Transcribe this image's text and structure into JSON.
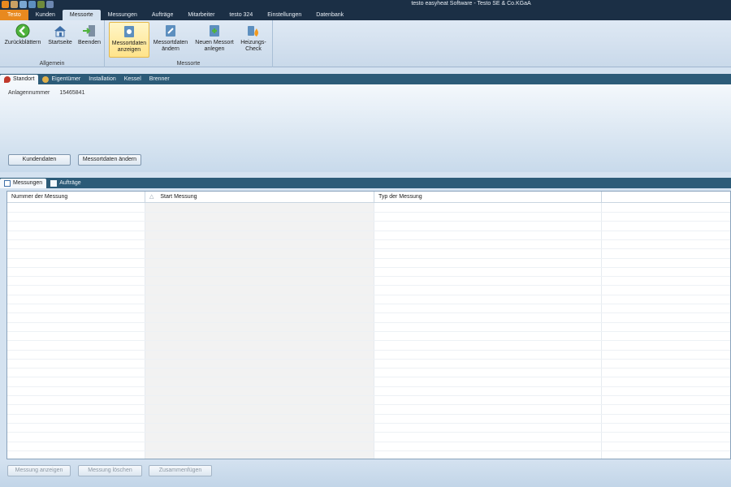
{
  "window": {
    "title": "testo easyheat Software - Testo SE & Co.KGaA"
  },
  "ribbon_tabs": [
    {
      "label": "Testo",
      "kind": "app"
    },
    {
      "label": "Kunden",
      "kind": "normal"
    },
    {
      "label": "Messorte",
      "kind": "active"
    },
    {
      "label": "Messungen",
      "kind": "normal"
    },
    {
      "label": "Aufträge",
      "kind": "normal"
    },
    {
      "label": "Mitarbeiter",
      "kind": "normal"
    },
    {
      "label": "testo 324",
      "kind": "normal"
    },
    {
      "label": "Einstellungen",
      "kind": "normal"
    },
    {
      "label": "Datenbank",
      "kind": "normal"
    }
  ],
  "ribbon": {
    "group_allgemein": {
      "label": "Allgemein",
      "back": "Zurückblättern",
      "home": "Startseite",
      "exit": "Beenden"
    },
    "group_messorte": {
      "label": "Messorte",
      "show": "Messortdaten\nanzeigen",
      "edit": "Messortdaten\nändern",
      "new": "Neuen Messort\nanlegen",
      "check": "Heizungs-\nCheck"
    }
  },
  "location_tabs": [
    "Standort",
    "Eigentümer",
    "Installation",
    "Kessel",
    "Brenner"
  ],
  "standort": {
    "field_label": "Anlagennummer",
    "field_value": "15465841",
    "btn_customer": "Kundendaten",
    "btn_edit": "Messortdaten ändern"
  },
  "bottom_tabs": [
    "Messungen",
    "Aufträge"
  ],
  "table": {
    "columns": [
      "Nummer der Messung",
      "Start Messung",
      "Typ der Messung"
    ],
    "sort_indicator": "△"
  },
  "actions": {
    "show": "Messung anzeigen",
    "delete": "Messung löschen",
    "merge": "Zusammenfügen"
  },
  "colors": {
    "accent": "#e8891f",
    "titlebar": "#1b2f45",
    "tabbar": "#2c5b78",
    "active_button": "#ffe38a"
  }
}
